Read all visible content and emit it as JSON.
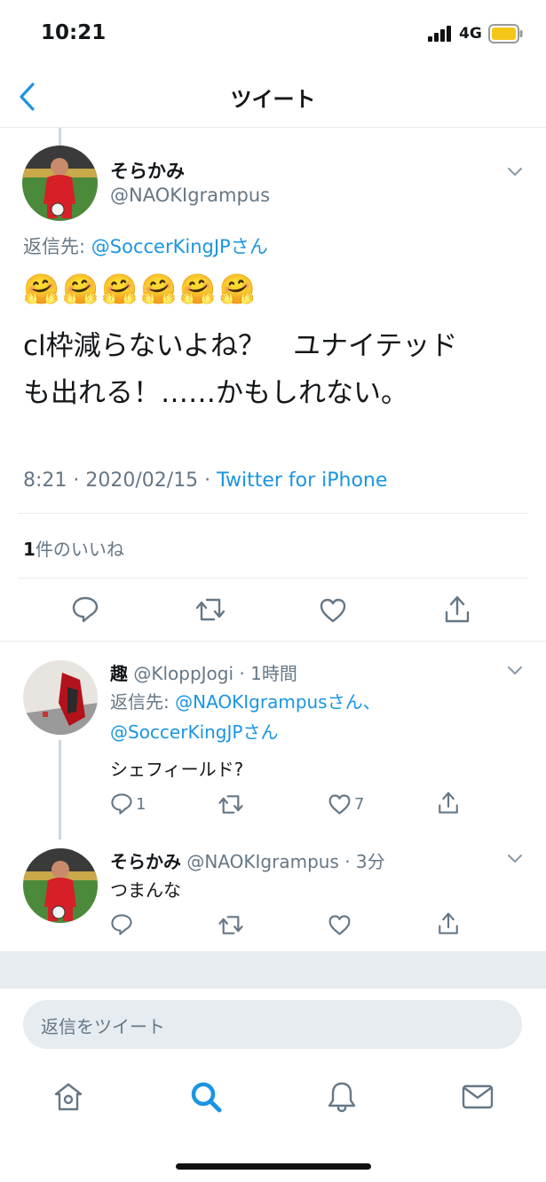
{
  "status_bar": {
    "time": "10:21",
    "network": "4G"
  },
  "header": {
    "title": "ツイート"
  },
  "main_tweet": {
    "display_name": "そらかみ",
    "handle": "@NAOKIgrampus",
    "reply_prefix": "返信先: ",
    "reply_to": "@SoccerKingJPさん",
    "emoji_line": "🤗🤗🤗🤗🤗🤗",
    "text_line1": "cl枠減らないよね？　ユナイテッド",
    "text_line2": "も出れる！……かもしれない。",
    "timestamp": "8:21 · 2020/02/15 · ",
    "source": "Twitter for iPhone",
    "likes_count": "1",
    "likes_label": "件のいいね"
  },
  "replies": [
    {
      "display_name": "趣",
      "meta": "@KloppJogi · 1時間",
      "reply_prefix": "返信先: ",
      "reply_to_1": "@NAOKIgrampusさん、",
      "reply_to_2": "@SoccerKingJPさん",
      "text": "シェフィールド?",
      "reply_count": "1",
      "retweet_count": "",
      "like_count": "7"
    },
    {
      "display_name": "そらかみ",
      "meta": "@NAOKIgrampus · 3分",
      "text": "つまんな"
    }
  ],
  "composer": {
    "placeholder": "返信をツイート"
  },
  "icons": [
    "back-chevron-icon",
    "chevron-down-icon",
    "reply-icon",
    "retweet-icon",
    "like-icon",
    "share-icon",
    "home-icon",
    "search-icon",
    "notifications-icon",
    "messages-icon"
  ],
  "colors": {
    "accent": "#1b95e0",
    "secondary_text": "#657786",
    "divider": "#e6ecf0"
  }
}
